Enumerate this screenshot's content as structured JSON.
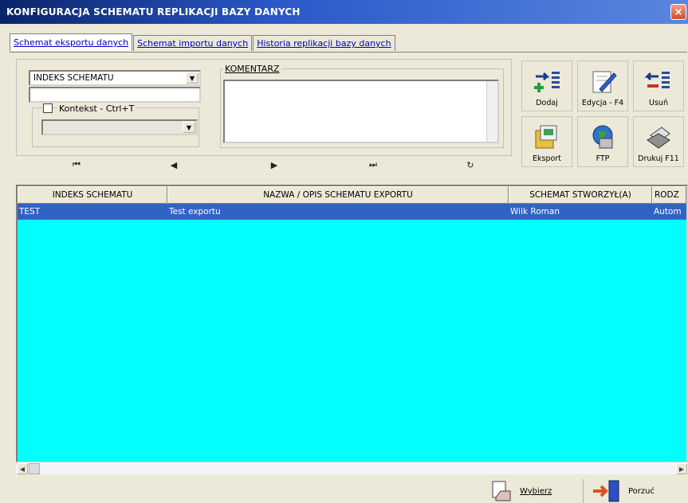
{
  "window": {
    "title": "KONFIGURACJA SCHEMATU REPLIKACJI BAZY DANYCH",
    "close": "×"
  },
  "tabs": [
    {
      "label": "Schemat eksportu danych",
      "active": true
    },
    {
      "label": "Schemat importu danych",
      "active": false
    },
    {
      "label": "Historia replikacji bazy danych",
      "active": false
    }
  ],
  "filter": {
    "index_select": "INDEKS SCHEMATU",
    "index_value": "",
    "context_label": "Kontekst - Ctrl+T",
    "context_value": "",
    "comment_label": "KOMENTARZ",
    "comment_value": ""
  },
  "nav": {
    "first": "⏮",
    "prev": "◀",
    "next": "▶",
    "last": "⏭",
    "refresh": "↻"
  },
  "toolbar": {
    "add": "Dodaj",
    "edit": "Edycja - F4",
    "delete": "Usuń",
    "export": "Eksport",
    "ftp": "FTP",
    "print": "Drukuj F11"
  },
  "table": {
    "headers": [
      "INDEKS SCHEMATU",
      "NAZWA / OPIS SCHEMATU EXPORTU",
      "SCHEMAT STWORZYŁ(A)",
      "RODZ"
    ],
    "rows": [
      [
        "TEST",
        "Test exportu",
        "Wilk Roman",
        "Autom"
      ]
    ]
  },
  "footer": {
    "select": "Wybierz",
    "cancel": "Porzuć"
  },
  "colors": {
    "title_bar": "#0a246a",
    "grid_bg": "#00ffff",
    "selected_row": "#3163c5"
  }
}
